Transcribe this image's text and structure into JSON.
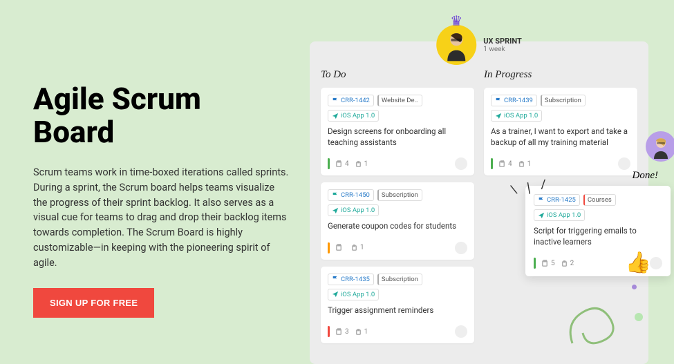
{
  "hero": {
    "title": "Agile Scrum Board",
    "description": "Scrum teams work in time-boxed iterations called sprints. During a sprint, the Scrum board helps teams visualize the progress of their sprint backlog. It also serves as a visual cue for teams to drag and drop their backlog items towards completion. The Scrum Board is highly customizable—in keeping with the pioneering spirit of agile.",
    "cta": "SIGN UP FOR FREE"
  },
  "sprint": {
    "name": "UX SPRINT",
    "duration": "1 week"
  },
  "columns": {
    "todo": {
      "title": "To Do",
      "cards": [
        {
          "id": "CRR-1442",
          "cat": "Website De..",
          "app": "iOS App 1.0",
          "text": "Design screens for onboarding all teaching assistants",
          "bar": "g",
          "c1": "4",
          "c2": "1"
        },
        {
          "id": "CRR-1450",
          "cat": "Subscription",
          "app": "iOS App 1.0",
          "text": "Generate coupon codes for students",
          "bar": "o",
          "c1": "",
          "c2": "1",
          "flag": "teal"
        },
        {
          "id": "CRR-1435",
          "cat": "Subscription",
          "app": "iOS App 1.0",
          "text": "Trigger assignment reminders",
          "bar": "r",
          "c1": "3",
          "c2": "1"
        }
      ]
    },
    "progress": {
      "title": "In Progress",
      "cards": [
        {
          "id": "CRR-1439",
          "cat": "Subscription",
          "app": "iOS App 1.0",
          "text": "As a trainer, I want to export and take a backup of all my training material",
          "bar": "g",
          "c1": "4",
          "c2": "1"
        }
      ]
    },
    "done": {
      "title": "Done!",
      "card": {
        "id": "CRR-1425",
        "cat": "Courses",
        "app": "iOS App 1.0",
        "text": "Script for triggering emails to inactive learners",
        "bar": "g",
        "c1": "5",
        "c2": "2"
      }
    }
  }
}
